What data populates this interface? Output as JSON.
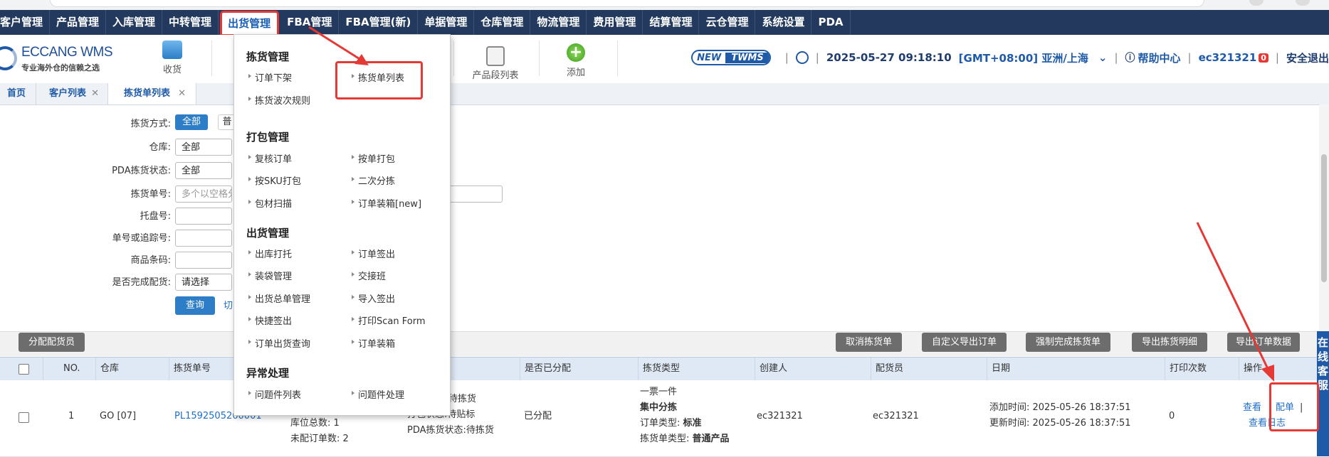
{
  "nav": {
    "items": [
      "客户管理",
      "产品管理",
      "入库管理",
      "中转管理",
      "出货管理",
      "FBA管理",
      "FBA管理(新)",
      "单据管理",
      "仓库管理",
      "物流管理",
      "费用管理",
      "结算管理",
      "云仓管理",
      "系统设置",
      "PDA"
    ],
    "active_index": 4
  },
  "header": {
    "brand": "ECCANG WMS",
    "slogan": "专业海外仓的信赖之选",
    "quick_items": [
      "收货",
      "产品段列表",
      "添加"
    ],
    "twms_new": "NEW",
    "twms_label": "TWMS",
    "datetime": "2025-05-27 09:18:10",
    "timezone": "[GMT+08:00] 亚洲/上海",
    "help": "帮助中心",
    "user": "ec321321",
    "badge": "0",
    "logout": "安全退出"
  },
  "tabs": [
    {
      "label": "首页",
      "closable": false
    },
    {
      "label": "客户列表",
      "closable": true
    },
    {
      "label": "拣货单列表",
      "closable": true
    }
  ],
  "filters": {
    "pick_method_label": "拣货方式:",
    "pick_method_all": "全部",
    "pick_method_partial": "普",
    "warehouse_label": "仓库:",
    "warehouse_value": "全部",
    "pda_status_label": "PDA拣货状态:",
    "pda_status_value": "全部",
    "pick_no_label": "拣货单号:",
    "pick_no_placeholder": "多个以空格分",
    "pallet_label": "托盘号:",
    "tracking_label": "单号或追踪号:",
    "barcode_label": "商品条码:",
    "completed_label": "是否完成配货:",
    "completed_value": "请选择",
    "query_button": "查询",
    "switch_link": "切"
  },
  "toolbar": {
    "assign_button": "分配配货员",
    "right_buttons": [
      "取消拣货单",
      "自定义导出订单",
      "强制完成拣货单",
      "导出拣货明细",
      "导出订单数据"
    ]
  },
  "table": {
    "headers": [
      "NO.",
      "仓库",
      "拣货单号",
      "",
      "是否已分配",
      "拣货类型",
      "创建人",
      "配货员",
      "日期",
      "打印次数",
      "操作"
    ],
    "row": {
      "no": "1",
      "warehouse": "GO [07]",
      "pick_no": "PL1592505260001",
      "location_total": "库位总数: 1",
      "unassigned_orders": "未配订单数: 2",
      "pick_status": "待拣货",
      "pack_status": "打包状态:待贴标",
      "pda_status": "PDA拣货状态:待拣货",
      "assigned": "已分配",
      "type_line1": "一票一件",
      "type_line2": "集中分拣",
      "order_type_label": "订单类型:",
      "order_type_value": "标准",
      "pick_sheet_type_label": "拣货单类型:",
      "pick_sheet_type_value": "普通产品",
      "creator": "ec321321",
      "picker": "ec321321",
      "added_time": "添加时间: 2025-05-26 18:37:51",
      "updated_time": "更新时间: 2025-05-26 18:37:51",
      "print_count": "0",
      "action_view": "查看",
      "action_assign": "配单",
      "action_log": "查看日志"
    }
  },
  "dropdown": {
    "sections": [
      {
        "title": "拣货管理",
        "items": [
          "订单下架",
          "拣货单列表",
          "拣货波次规则"
        ]
      },
      {
        "title": "打包管理",
        "items": [
          "复核订单",
          "按单打包",
          "按SKU打包",
          "二次分拣",
          "包材扫描",
          "订单装箱[new]"
        ]
      },
      {
        "title": "出货管理",
        "items": [
          "出库打托",
          "订单签出",
          "装袋管理",
          "交接班",
          "出货总单管理",
          "导入签出",
          "快捷签出",
          "打印Scan Form",
          "订单出货查询",
          "订单装箱"
        ]
      },
      {
        "title": "异常处理",
        "items": [
          "问题件列表",
          "问题件处理"
        ]
      }
    ]
  },
  "sidebar_tab": "在线客服"
}
